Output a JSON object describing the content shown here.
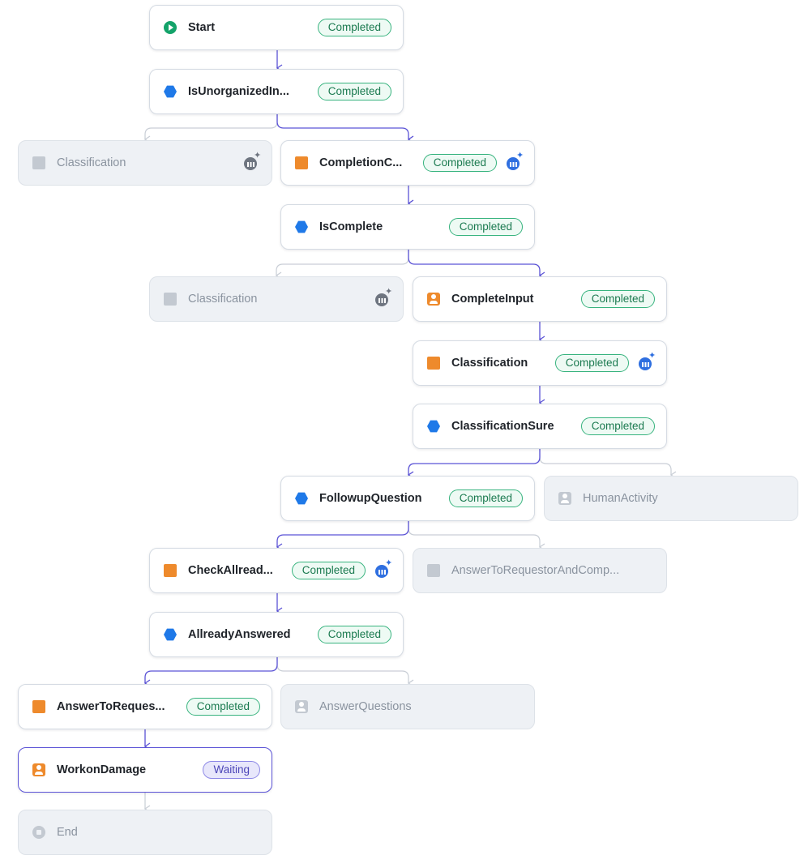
{
  "status": {
    "completed": "Completed",
    "waiting": "Waiting"
  },
  "nodes": [
    {
      "id": "start",
      "label": "Start",
      "status": "Completed"
    },
    {
      "id": "is-unorganized",
      "label": "IsUnorganizedIn...",
      "status": "Completed"
    },
    {
      "id": "classification-1",
      "label": "Classification"
    },
    {
      "id": "completion-check",
      "label": "CompletionC...",
      "status": "Completed"
    },
    {
      "id": "is-complete",
      "label": "IsComplete",
      "status": "Completed"
    },
    {
      "id": "classification-2",
      "label": "Classification"
    },
    {
      "id": "complete-input",
      "label": "CompleteInput",
      "status": "Completed"
    },
    {
      "id": "classification-3",
      "label": "Classification",
      "status": "Completed"
    },
    {
      "id": "classification-sure",
      "label": "ClassificationSure",
      "status": "Completed"
    },
    {
      "id": "followup-question",
      "label": "FollowupQuestion",
      "status": "Completed"
    },
    {
      "id": "human-activity",
      "label": "HumanActivity"
    },
    {
      "id": "check-already",
      "label": "CheckAllread...",
      "status": "Completed"
    },
    {
      "id": "answer-to-requestor-complete",
      "label": "AnswerToRequestorAndComp..."
    },
    {
      "id": "already-answered",
      "label": "AllreadyAnswered",
      "status": "Completed"
    },
    {
      "id": "answer-to-requestor",
      "label": "AnswerToReques...",
      "status": "Completed"
    },
    {
      "id": "answer-questions",
      "label": "AnswerQuestions"
    },
    {
      "id": "work-on-damage",
      "label": "WorkonDamage",
      "status": "Waiting"
    },
    {
      "id": "end",
      "label": "End"
    }
  ],
  "icons": {
    "start": "play-circle-icon",
    "gateway": "hexagon-gateway-icon",
    "task": "square-task-icon",
    "user_task": "user-task-icon",
    "ai": "ai-agent-icon",
    "end": "stop-circle-icon"
  },
  "colors": {
    "active_edge": "#5b53d6",
    "inactive_edge": "#c9ced6",
    "completed": "#37b37e",
    "waiting": "#8c87e6",
    "task": "#ee8a2c",
    "gateway": "#1f79e8",
    "start": "#14a36a"
  }
}
